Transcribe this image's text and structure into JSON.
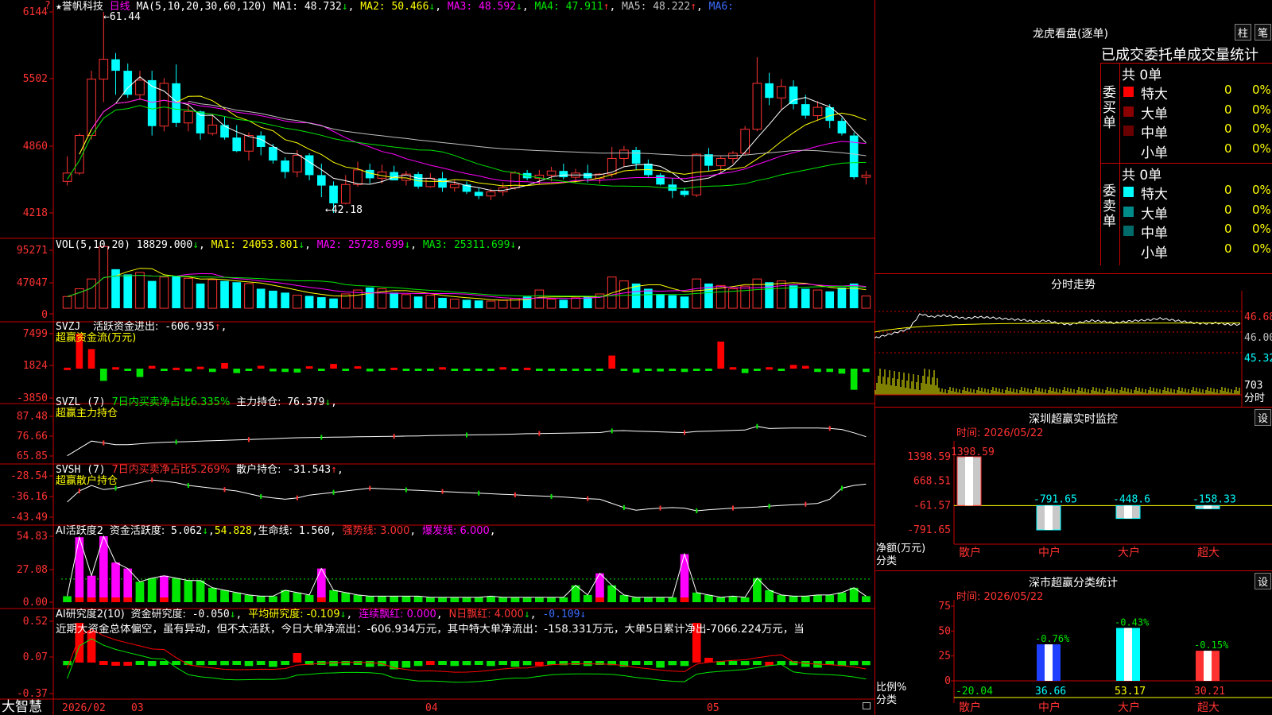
{
  "chart": {
    "title_star": "★",
    "stock_name": "誉帆科技",
    "period": "日线",
    "ma_params": "MA(5,10,20,30,60,120)",
    "ma_values": [
      {
        "label": "MA1:",
        "value": "48.732",
        "arrow": "↓",
        "color": "#ffffff"
      },
      {
        "label": "MA2:",
        "value": "50.466",
        "arrow": "↓",
        "color": "#ffff00"
      },
      {
        "label": "MA3:",
        "value": "48.592",
        "arrow": "↓",
        "color": "#ff00ff"
      },
      {
        "label": "MA4:",
        "value": "47.911",
        "arrow": "↑",
        "color": "#00e600"
      },
      {
        "label": "MA5:",
        "value": "48.222",
        "arrow": "↑",
        "color": "#c0c0c0"
      },
      {
        "label": "MA6:",
        "value": "",
        "arrow": "",
        "color": "#3c6cff"
      }
    ],
    "price_axis": [
      "6144",
      "5502",
      "4860",
      "4218"
    ],
    "high_label": "61.44",
    "low_label": "42.18",
    "price_top_marker": "?",
    "vol_title": "VOL(5,10,20)",
    "vol_values": [
      {
        "label": "",
        "value": "18829.000",
        "arrow": "↓",
        "color": "#ffffff"
      },
      {
        "label": "MA1:",
        "value": "24053.801",
        "arrow": "↓",
        "color": "#ffff00"
      },
      {
        "label": "MA2:",
        "value": "25728.699",
        "arrow": "↓",
        "color": "#ff00ff"
      },
      {
        "label": "MA3:",
        "value": "25311.699",
        "arrow": "↓",
        "color": "#00e600"
      }
    ],
    "vol_axis": [
      "95271",
      "47047",
      "0"
    ],
    "svzj_title": "SVZJ",
    "svzj_label": "活跃资金进出:",
    "svzj_value": "-606.935",
    "svzj_arrow": "↑",
    "svzj_sub": "超赢资金流(万元)",
    "svzj_axis": [
      "7499",
      "1824",
      "-3850"
    ],
    "svzl_title": "SVZL (7)",
    "svzl_text1": "7日内买卖净占比6.335%",
    "svzl_label": "主力持仓:",
    "svzl_value": "76.379",
    "svzl_arrow": "↓",
    "svzl_sub": "超赢主力持仓",
    "svzl_axis": [
      "87.48",
      "76.66",
      "65.85"
    ],
    "svsh_title": "SVSH (7)",
    "svsh_text1": "7日内买卖净占比5.269%",
    "svsh_label": "散户持仓:",
    "svsh_value": "-31.543",
    "svsh_arrow": "↑",
    "svsh_sub": "超赢散户持仓",
    "svsh_axis": [
      "-28.54",
      "-36.16",
      "-43.49"
    ],
    "ai1_title": "AI活跃度2",
    "ai1_label": "资金活跃度:",
    "ai1_value": "5.062",
    "ai1_arrow": "↓",
    "ai1_v2": "54.828",
    "ai1_life_label": "生命线:",
    "ai1_life": "1.560",
    "ai1_strong": "强势线: 3.000",
    "ai1_burst": "爆发线: 6.000",
    "ai1_axis": [
      "54.83",
      "27.08",
      "0.00"
    ],
    "ai2_title": "AI研究度2(10)",
    "ai2_label": "资金研究度:",
    "ai2_value": "-0.050",
    "ai2_arrow": "↓",
    "ai2_avg": "平均研究度: -0.109",
    "ai2_avg_arrow": "↓",
    "ai2_cont": "连续飘红: 0.000",
    "ai2_n": "N日飘红: 4.000",
    "ai2_n_arrow": "↓",
    "ai2_last": "-0.109",
    "ai2_last_arrow": "↓",
    "ai2_comment": "近期大资金总体偏空，虽有异动，但不太活跃，今日大单净流出：-606.934万元，其中特大单净流出：-158.331万元，大单5日累计净出-7066.224万元，当",
    "ai2_axis": [
      "0.52",
      "0.07",
      "-0.37"
    ],
    "date_labels": [
      "2026/02",
      "03",
      "04",
      "05"
    ],
    "brand": "大智慧"
  },
  "right": {
    "dragon_title": "龙虎看盘(逐单)",
    "btn_zhu": "柱",
    "btn_bi": "笔",
    "stats_header": "已成交委托单成交量统计",
    "buy_side": "委买单",
    "sell_side": "委卖单",
    "buy_total": "共 0单",
    "sell_total": "共 0单",
    "buy_rows": [
      {
        "name": "特大",
        "count": "0",
        "pct": "0%",
        "color": "#ff0000"
      },
      {
        "name": "大单",
        "count": "0",
        "pct": "0%",
        "color": "#8b0000"
      },
      {
        "name": "中单",
        "count": "0",
        "pct": "0%",
        "color": "#6b0000"
      },
      {
        "name": "小单",
        "count": "0",
        "pct": "0%",
        "color": ""
      }
    ],
    "sell_rows": [
      {
        "name": "特大",
        "count": "0",
        "pct": "0%",
        "color": "#00ffff"
      },
      {
        "name": "大单",
        "count": "0",
        "pct": "0%",
        "color": "#008b8b"
      },
      {
        "name": "中单",
        "count": "0",
        "pct": "0%",
        "color": "#006b6b"
      },
      {
        "name": "小单",
        "count": "0",
        "pct": "0%",
        "color": ""
      }
    ],
    "intraday_title": "分时走势",
    "intraday_axis": [
      "46.68",
      "46.00",
      "45.32"
    ],
    "intraday_vol": "703",
    "intraday_unit": "分时",
    "sz_monitor_title": "深圳超赢实时监控",
    "sz_monitor_set": "设",
    "sz_monitor_time": "时间: 2026/05/22",
    "sz_monitor_ylabel": "净额(万元)",
    "sz_monitor_xlabel": "分类",
    "sz_monitor_axis": [
      "1398.59",
      "668.51",
      "-61.57",
      "-791.65"
    ],
    "sz_cls_title": "深市超赢分类统计",
    "sz_cls_set": "设",
    "sz_cls_time": "时间: 2026/05/22",
    "sz_cls_ylabel": "比例%",
    "sz_cls_xlabel": "分类",
    "sz_cls_axis": [
      "75",
      "50",
      "25",
      "0"
    ]
  },
  "chart_data": [
    {
      "type": "candlestick",
      "title": "誉帆科技 日线",
      "ylim": [
        42.18,
        61.44
      ],
      "ohlc": [
        [
          45.2,
          47.6,
          44.8,
          46.0
        ],
        [
          46.0,
          49.8,
          45.8,
          49.6
        ],
        [
          49.6,
          55.8,
          49.2,
          55.0
        ],
        [
          55.0,
          61.44,
          52.8,
          56.9
        ],
        [
          56.9,
          57.5,
          53.5,
          55.8
        ],
        [
          55.8,
          56.5,
          53.2,
          53.5
        ],
        [
          53.5,
          55.8,
          53.0,
          54.9
        ],
        [
          54.9,
          55.8,
          49.6,
          50.5
        ],
        [
          50.5,
          55.1,
          50.0,
          54.6
        ],
        [
          54.6,
          56.4,
          50.4,
          50.8
        ],
        [
          50.8,
          52.8,
          50.0,
          51.9
        ],
        [
          51.9,
          52.0,
          49.2,
          49.8
        ],
        [
          49.8,
          51.6,
          49.6,
          50.6
        ],
        [
          50.6,
          51.4,
          49.2,
          49.4
        ],
        [
          49.4,
          50.6,
          48.0,
          48.1
        ],
        [
          48.1,
          49.9,
          47.2,
          49.6
        ],
        [
          49.6,
          50.0,
          47.7,
          48.5
        ],
        [
          48.5,
          48.8,
          46.9,
          47.2
        ],
        [
          47.2,
          47.5,
          45.5,
          46.1
        ],
        [
          46.1,
          48.2,
          45.6,
          47.7
        ],
        [
          47.7,
          47.9,
          45.3,
          45.8
        ],
        [
          45.8,
          46.9,
          43.7,
          44.8
        ],
        [
          44.8,
          45.2,
          42.18,
          43.1
        ],
        [
          43.1,
          45.8,
          43.0,
          44.9
        ],
        [
          44.9,
          47.1,
          44.7,
          46.3
        ],
        [
          46.3,
          46.9,
          45.0,
          45.5
        ],
        [
          45.5,
          46.8,
          45.0,
          46.1
        ],
        [
          46.1,
          46.7,
          45.3,
          45.3
        ],
        [
          45.3,
          46.2,
          44.8,
          45.9
        ],
        [
          45.9,
          46.1,
          44.5,
          44.7
        ],
        [
          44.7,
          46.0,
          44.6,
          45.5
        ],
        [
          45.5,
          46.1,
          44.2,
          44.6
        ],
        [
          44.6,
          45.3,
          44.2,
          44.9
        ],
        [
          44.9,
          45.2,
          44.0,
          44.2
        ],
        [
          44.2,
          44.6,
          43.5,
          43.8
        ],
        [
          43.8,
          44.5,
          43.4,
          44.2
        ],
        [
          44.2,
          45.1,
          43.8,
          44.6
        ],
        [
          44.6,
          46.2,
          44.4,
          46.0
        ],
        [
          46.0,
          46.3,
          45.3,
          45.5
        ],
        [
          45.5,
          46.3,
          44.9,
          45.8
        ],
        [
          45.8,
          46.6,
          45.2,
          46.2
        ],
        [
          46.2,
          46.9,
          45.4,
          45.6
        ],
        [
          45.6,
          46.4,
          45.0,
          46.0
        ],
        [
          46.0,
          46.8,
          45.1,
          45.5
        ],
        [
          45.5,
          46.0,
          45.0,
          45.9
        ],
        [
          45.9,
          48.5,
          45.6,
          47.4
        ],
        [
          47.4,
          48.6,
          46.6,
          48.2
        ],
        [
          48.2,
          48.5,
          46.3,
          46.9
        ],
        [
          46.9,
          47.3,
          45.6,
          45.8
        ],
        [
          45.8,
          46.0,
          44.8,
          44.9
        ],
        [
          44.9,
          45.5,
          43.6,
          44.3
        ],
        [
          44.3,
          44.6,
          43.7,
          43.9
        ],
        [
          43.9,
          47.9,
          43.7,
          47.8
        ],
        [
          47.8,
          48.4,
          46.2,
          46.7
        ],
        [
          46.7,
          47.6,
          46.1,
          47.4
        ],
        [
          47.4,
          48.1,
          46.9,
          47.9
        ],
        [
          47.9,
          50.5,
          47.7,
          50.2
        ],
        [
          50.2,
          57.1,
          50.0,
          54.6
        ],
        [
          54.6,
          55.6,
          52.5,
          53.2
        ],
        [
          53.2,
          55.0,
          52.1,
          54.3
        ],
        [
          54.3,
          54.9,
          52.1,
          52.6
        ],
        [
          52.6,
          53.5,
          51.2,
          51.5
        ],
        [
          51.5,
          52.9,
          51.0,
          52.3
        ],
        [
          52.3,
          52.6,
          50.3,
          51.0
        ],
        [
          51.0,
          51.3,
          49.6,
          49.8
        ],
        [
          49.6,
          49.9,
          45.4,
          45.6
        ],
        [
          45.6,
          46.2,
          44.9,
          45.8
        ]
      ]
    },
    {
      "type": "bar",
      "title": "VOL(5,10,20)",
      "ylim": [
        0,
        95271
      ],
      "values": [
        18000,
        30000,
        45000,
        95000,
        60000,
        52000,
        55000,
        42000,
        48000,
        50000,
        46000,
        38000,
        44000,
        42000,
        40000,
        38000,
        30000,
        27000,
        24000,
        20000,
        19000,
        17000,
        15000,
        22000,
        28000,
        32000,
        30000,
        24000,
        21000,
        18000,
        20000,
        16000,
        14000,
        13000,
        12000,
        11000,
        12000,
        15000,
        18000,
        28000,
        14000,
        13000,
        16000,
        18000,
        22000,
        48000,
        42000,
        38000,
        30000,
        22000,
        20000,
        18000,
        45000,
        38000,
        35000,
        30000,
        34000,
        45000,
        40000,
        42000,
        35000,
        30000,
        28000,
        26000,
        32000,
        38000,
        18829
      ],
      "ma_values_current": {
        "vol": 18829.0,
        "MA1": 24053.801,
        "MA2": 25728.699,
        "MA3": 25311.699
      }
    },
    {
      "type": "bar",
      "title": "超赢资金流(万元)",
      "ylim": [
        -3850,
        7499
      ],
      "values": [
        200,
        7499,
        4200,
        -2200,
        300,
        -400,
        -1500,
        600,
        -300,
        200,
        -500,
        400,
        -600,
        1200,
        -800,
        -300,
        600,
        -500,
        -600,
        -700,
        500,
        -400,
        1000,
        -300,
        500,
        -500,
        -400,
        200,
        -300,
        -300,
        -400,
        300,
        -300,
        -300,
        -200,
        -400,
        300,
        -200,
        200,
        -300,
        -200,
        -300,
        -300,
        -300,
        -200,
        2800,
        -300,
        -700,
        -400,
        -500,
        -200,
        -600,
        -200,
        -300,
        5800,
        300,
        -800,
        -200,
        300,
        -300,
        800,
        600,
        -600,
        -600,
        -900,
        -3800,
        -606.935
      ]
    },
    {
      "type": "line",
      "title": "超赢主力持仓",
      "ylim": [
        65.85,
        87.48
      ],
      "series": [
        {
          "name": "主力持仓",
          "values": [
            66,
            70,
            74,
            73,
            72,
            72,
            72.5,
            73,
            73.3,
            73.5,
            73.7,
            74,
            74.2,
            74.4,
            74.6,
            74.8,
            75,
            75.3,
            75.6,
            75.8,
            75.9,
            76,
            76.1,
            76.2,
            76.3,
            76.4,
            76.5,
            76.6,
            76.7,
            76.8,
            77,
            77.1,
            77.2,
            77.3,
            77.4,
            77.5,
            77.6,
            77.8,
            78,
            78.1,
            78.2,
            78.3,
            78.4,
            78.5,
            78.6,
            79.5,
            79.7,
            79.4,
            79.2,
            79,
            78.8,
            78.6,
            79.2,
            79.4,
            79.6,
            79.8,
            80,
            82,
            80.8,
            81,
            81.1,
            81.1,
            81.1,
            80.9,
            80.3,
            78.5,
            76.379
          ]
        }
      ]
    },
    {
      "type": "line",
      "title": "超赢散户持仓",
      "ylim": [
        -43.49,
        -28.54
      ],
      "series": [
        {
          "name": "散户持仓",
          "values": [
            -38,
            -34,
            -32,
            -33.5,
            -33,
            -32,
            -31,
            -30,
            -30.5,
            -31,
            -32,
            -32.5,
            -33,
            -33.5,
            -34,
            -35,
            -36,
            -36.5,
            -37,
            -36.5,
            -35.5,
            -35,
            -34.5,
            -34,
            -33.5,
            -33,
            -33.2,
            -33.4,
            -33.6,
            -33.8,
            -34,
            -34.2,
            -34.4,
            -34.6,
            -34.8,
            -35,
            -35.2,
            -35.4,
            -35.6,
            -35.8,
            -36,
            -36.2,
            -36.5,
            -36.8,
            -37,
            -38.5,
            -40,
            -41,
            -40.5,
            -40.2,
            -40,
            -40.2,
            -41.2,
            -40.8,
            -40.5,
            -40.2,
            -40,
            -39.8,
            -39.5,
            -39.2,
            -39,
            -38.8,
            -38.5,
            -37,
            -33,
            -32,
            -31.543
          ]
        }
      ]
    },
    {
      "type": "bar",
      "title": "AI活跃度2",
      "ylim": [
        0,
        54.83
      ],
      "values": [
        5,
        54,
        22,
        54.83,
        33,
        28,
        17,
        20,
        22,
        20,
        18,
        18,
        12,
        10,
        8,
        6,
        5,
        5,
        10,
        8,
        6,
        28,
        10,
        8,
        6,
        5,
        5,
        5,
        5,
        5,
        4,
        4,
        4,
        4,
        4,
        5,
        4,
        4,
        4,
        4,
        4,
        4,
        14,
        6,
        24,
        14,
        6,
        4,
        4,
        4,
        4,
        40,
        8,
        6,
        4,
        5,
        4,
        20,
        10,
        6,
        5,
        5,
        6,
        6,
        8,
        12,
        5.062
      ],
      "strong_line": 3.0,
      "burst_line": 6.0,
      "life_line": 1.56
    },
    {
      "type": "bar",
      "title": "AI研究度2(10)",
      "ylim": [
        -0.37,
        0.52
      ],
      "values": [
        -0.05,
        0.5,
        0.4,
        0.02,
        0.01,
        0.01,
        -0.02,
        -0.06,
        -0.03,
        -0.01,
        -0.02,
        -0.05,
        -0.01,
        -0.05,
        -0.03,
        -0.06,
        -0.04,
        -0.07,
        -0.04,
        0.12,
        -0.04,
        -0.03,
        -0.06,
        -0.05,
        -0.04,
        -0.07,
        -0.06,
        -0.1,
        -0.08,
        -0.06,
        0.02,
        -0.03,
        -0.06,
        -0.05,
        -0.03,
        -0.06,
        -0.04,
        -0.07,
        -0.05,
        0.01,
        -0.02,
        -0.05,
        -0.03,
        -0.06,
        -0.02,
        -0.05,
        -0.07,
        -0.04,
        -0.03,
        -0.08,
        -0.05,
        -0.06,
        0.5,
        0.06,
        -0.04,
        -0.03,
        -0.05,
        -0.02,
        0.01,
        -0.04,
        -0.05,
        -0.07,
        -0.08,
        -0.03,
        -0.06,
        -0.05,
        -0.05
      ]
    },
    {
      "type": "line",
      "title": "分时走势",
      "ylim": [
        45.32,
        46.68
      ],
      "series": [
        {
          "name": "price",
          "values": [
            45.8,
            45.9,
            46.0,
            46.1,
            46.6,
            46.5,
            46.55,
            46.5,
            46.45,
            46.5,
            46.48,
            46.45,
            46.42,
            46.4,
            46.35,
            46.38,
            46.3,
            46.25,
            46.32,
            46.38,
            46.35,
            46.3,
            46.35,
            46.38,
            46.4,
            46.45,
            46.4,
            46.35,
            46.3,
            46.28,
            46.3,
            46.25,
            46.25
          ]
        }
      ]
    },
    {
      "type": "bar",
      "title": "深圳超赢实时监控",
      "categories": [
        "散户",
        "中户",
        "大户",
        "超大"
      ],
      "values": [
        1398.59,
        -791.65,
        -448.6,
        -158.33
      ],
      "ylim": [
        -791.65,
        1398.59
      ]
    },
    {
      "type": "bar",
      "title": "深市超赢分类统计",
      "categories": [
        "散户",
        "中户",
        "大户",
        "超大"
      ],
      "values": [
        -20.04,
        36.66,
        53.17,
        30.21
      ],
      "changes": [
        "",
        "-0.76%",
        "-0.43%",
        "-0.15%"
      ],
      "ylim": [
        0,
        75
      ]
    }
  ]
}
